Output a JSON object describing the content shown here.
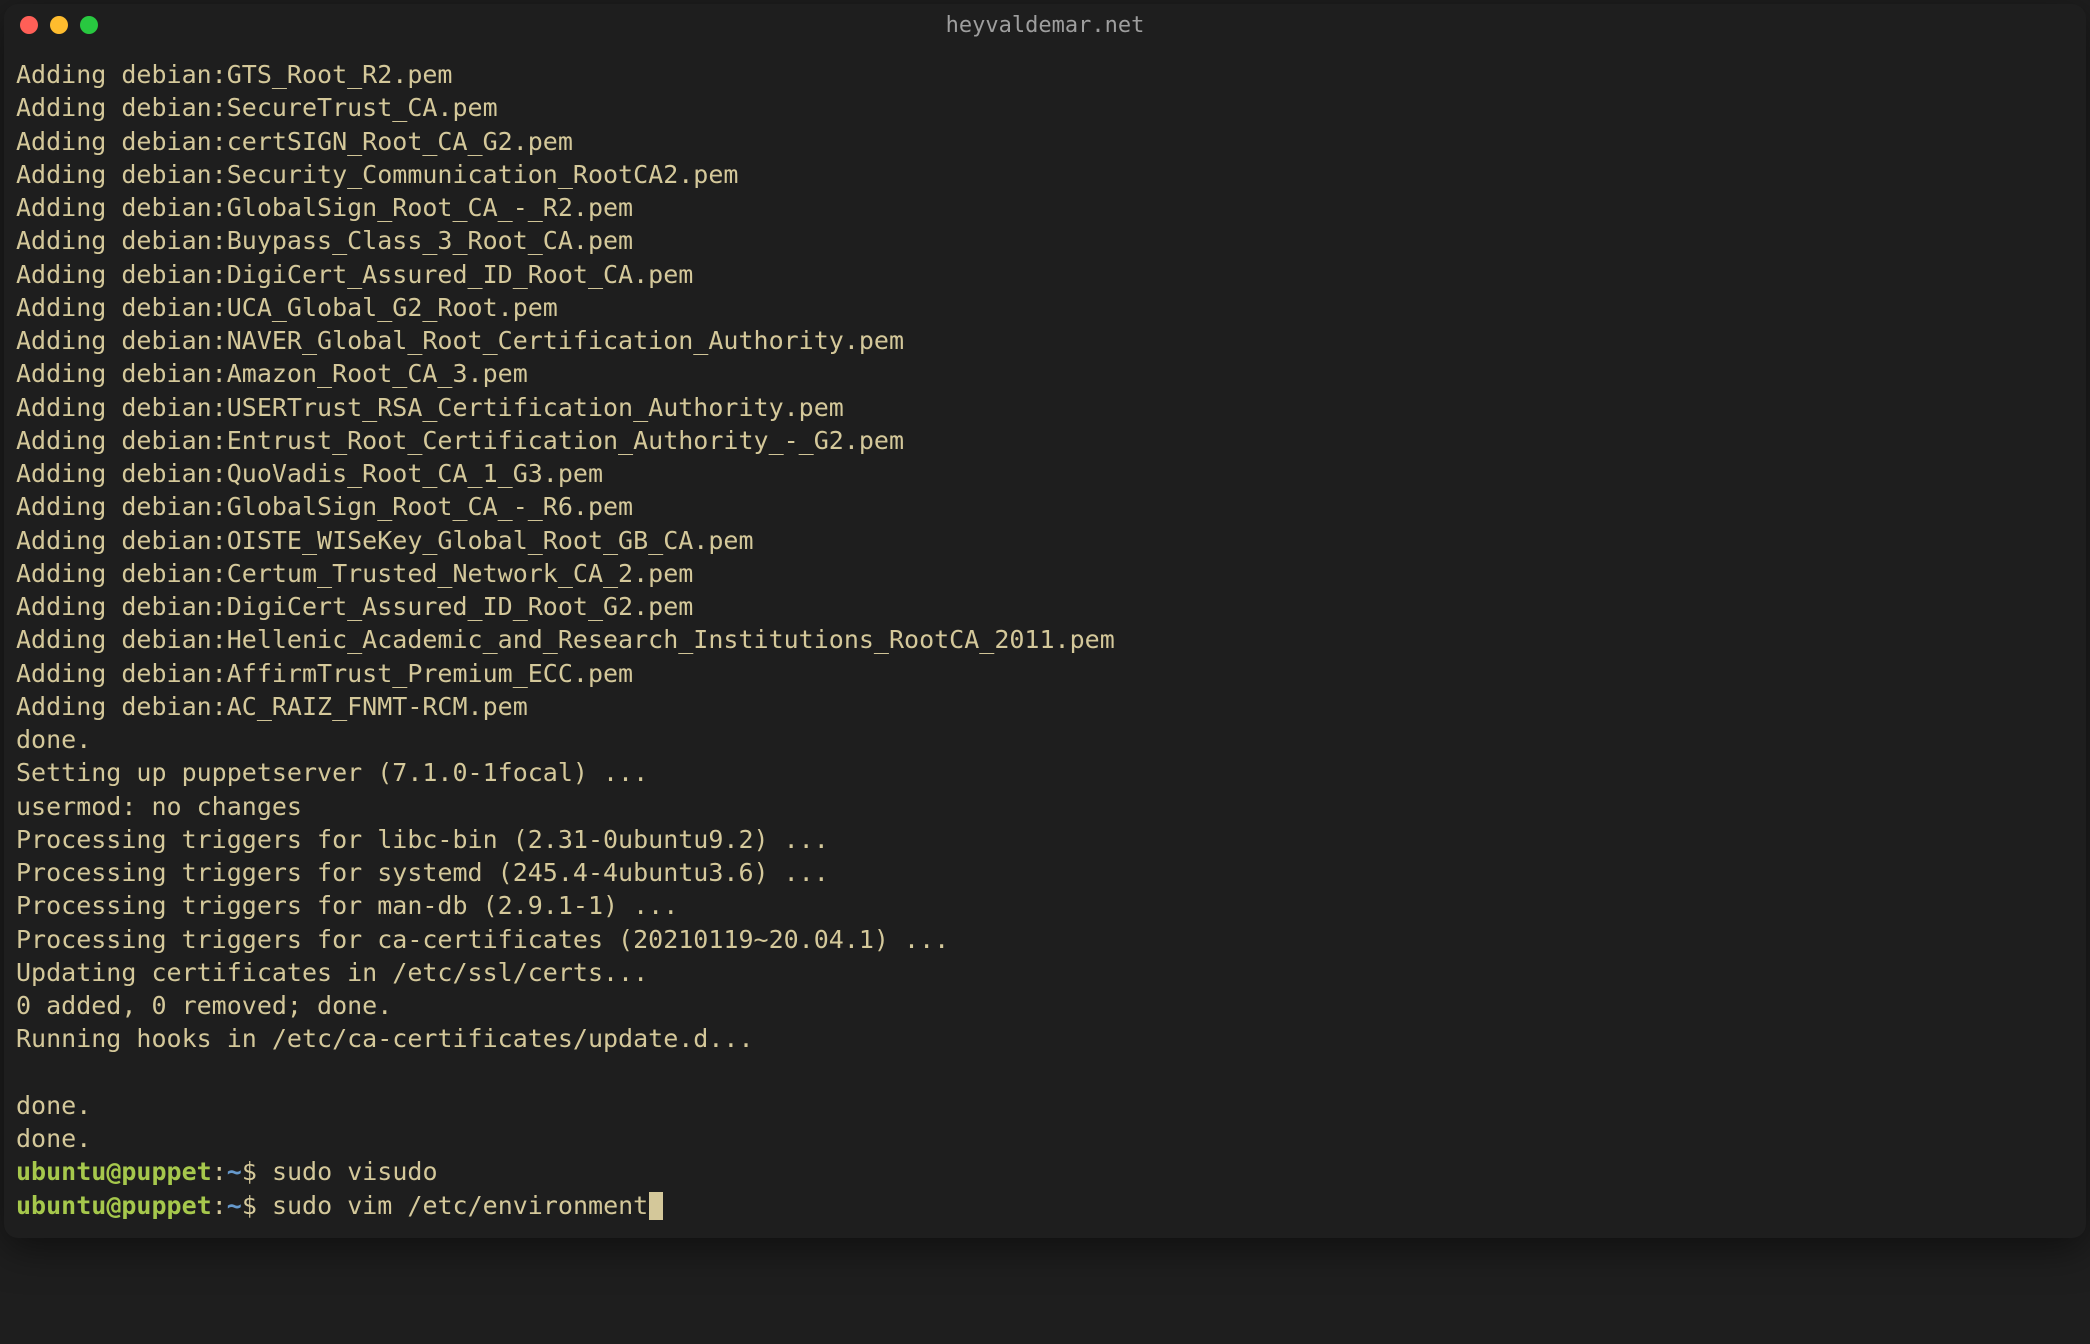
{
  "window": {
    "title": "heyvaldemar.net"
  },
  "output_lines": [
    "Adding debian:GTS_Root_R2.pem",
    "Adding debian:SecureTrust_CA.pem",
    "Adding debian:certSIGN_Root_CA_G2.pem",
    "Adding debian:Security_Communication_RootCA2.pem",
    "Adding debian:GlobalSign_Root_CA_-_R2.pem",
    "Adding debian:Buypass_Class_3_Root_CA.pem",
    "Adding debian:DigiCert_Assured_ID_Root_CA.pem",
    "Adding debian:UCA_Global_G2_Root.pem",
    "Adding debian:NAVER_Global_Root_Certification_Authority.pem",
    "Adding debian:Amazon_Root_CA_3.pem",
    "Adding debian:USERTrust_RSA_Certification_Authority.pem",
    "Adding debian:Entrust_Root_Certification_Authority_-_G2.pem",
    "Adding debian:QuoVadis_Root_CA_1_G3.pem",
    "Adding debian:GlobalSign_Root_CA_-_R6.pem",
    "Adding debian:OISTE_WISeKey_Global_Root_GB_CA.pem",
    "Adding debian:Certum_Trusted_Network_CA_2.pem",
    "Adding debian:DigiCert_Assured_ID_Root_G2.pem",
    "Adding debian:Hellenic_Academic_and_Research_Institutions_RootCA_2011.pem",
    "Adding debian:AffirmTrust_Premium_ECC.pem",
    "Adding debian:AC_RAIZ_FNMT-RCM.pem",
    "done.",
    "Setting up puppetserver (7.1.0-1focal) ...",
    "usermod: no changes",
    "Processing triggers for libc-bin (2.31-0ubuntu9.2) ...",
    "Processing triggers for systemd (245.4-4ubuntu3.6) ...",
    "Processing triggers for man-db (2.9.1-1) ...",
    "Processing triggers for ca-certificates (20210119~20.04.1) ...",
    "Updating certificates in /etc/ssl/certs...",
    "0 added, 0 removed; done.",
    "Running hooks in /etc/ca-certificates/update.d...",
    "",
    "done.",
    "done."
  ],
  "prompts": [
    {
      "user": "ubuntu",
      "host": "puppet",
      "path": "~",
      "symbol": "$",
      "command": "sudo visudo",
      "cursor": false
    },
    {
      "user": "ubuntu",
      "host": "puppet",
      "path": "~",
      "symbol": "$",
      "command": "sudo vim /etc/environment",
      "cursor": true
    }
  ]
}
